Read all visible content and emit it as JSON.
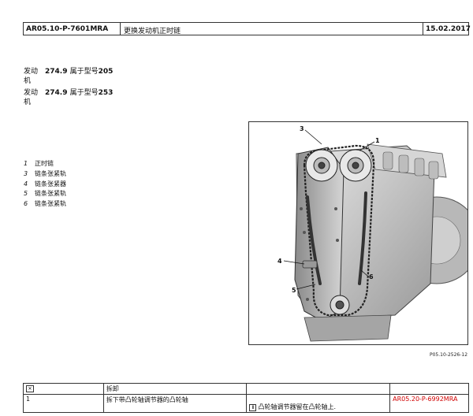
{
  "header": {
    "code": "AR05.10-P-7601MRA",
    "title": "更换发动机正时链",
    "date": "15.02.2017"
  },
  "engines": [
    {
      "label_1": "发动",
      "label_2": "机",
      "model": "274.9",
      "desc": "属于型号",
      "type": "205"
    },
    {
      "label_1": "发动",
      "label_2": "机",
      "model": "274.9",
      "desc": "属于型号",
      "type": "253"
    }
  ],
  "legend": [
    {
      "num": "1",
      "text": "正时链"
    },
    {
      "num": "3",
      "text": "链条张紧轨"
    },
    {
      "num": "4",
      "text": "链条张紧器"
    },
    {
      "num": "5",
      "text": "链条张紧轨"
    },
    {
      "num": "6",
      "text": "链条张紧轨"
    }
  ],
  "figure": {
    "callouts": [
      "3",
      "1",
      "4",
      "6",
      "5"
    ],
    "code": "P05.10-2526-12"
  },
  "steps_table": {
    "header_label": "拆卸",
    "rows": [
      {
        "num": "1",
        "text": "拆下带凸轮轴调节器的凸轮轴",
        "note": "凸轮轴调节器留在凸轮轴上.",
        "ref": "AR05.20-P-6992MRA"
      }
    ]
  }
}
